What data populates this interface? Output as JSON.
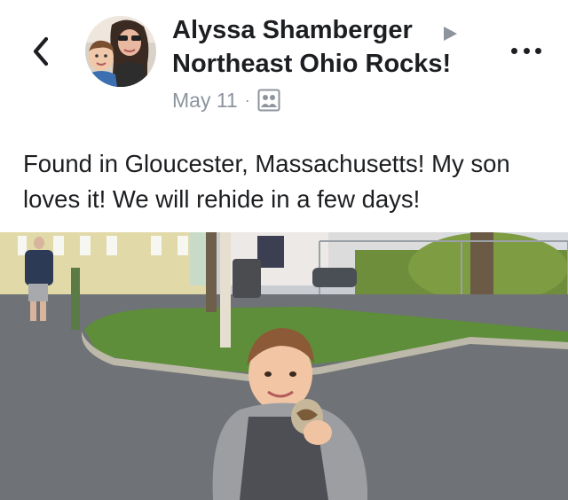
{
  "post": {
    "author": "Alyssa Shamberger",
    "group": "Northeast Ohio Rocks!",
    "date": "May 11",
    "separator": "·",
    "text": "Found in Gloucester, Massachusetts! My son loves it! We will rehide in a few days!"
  },
  "icons": {
    "back": "chevron-left-icon",
    "arrow": "triangle-right-icon",
    "audience": "group-audience-icon",
    "more": "more-horizontal-icon"
  },
  "colors": {
    "text": "#1c1e21",
    "meta": "#8d949e"
  }
}
